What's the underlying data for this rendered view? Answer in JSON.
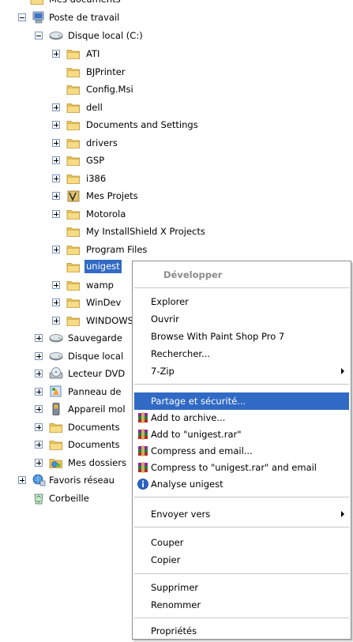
{
  "tree": {
    "top_partial": "Mes documents",
    "root": "Poste de travail",
    "drive_c": "Disque local (C:)",
    "folders": {
      "ati": "ATI",
      "bjprinter": "BJPrinter",
      "configmsi": "Config.Msi",
      "dell": "dell",
      "docsettings": "Documents and Settings",
      "drivers": "drivers",
      "gsp": "GSP",
      "i386": "i386",
      "mesprojets": "Mes Projets",
      "motorola": "Motorola",
      "installshield": "My InstallShield X Projects",
      "programfiles": "Program Files",
      "unigest": "unigest",
      "wamp": "wamp",
      "windev": "WinDev",
      "windows": "WINDOWS"
    },
    "others": {
      "sauvegarde": "Sauvegarde",
      "disque_local": "Disque local",
      "lecteur_dvd": "Lecteur DVD",
      "panneau": "Panneau de",
      "appareil": "Appareil mol",
      "documents1": "Documents",
      "documents2": "Documents",
      "mes_dossiers": "Mes dossiers"
    },
    "favoris": "Favoris réseau",
    "corbeille": "Corbeille"
  },
  "menu": {
    "developper": "Développer",
    "explorer": "Explorer",
    "ouvrir": "Ouvrir",
    "paintshop": "Browse With Paint Shop Pro 7",
    "rechercher": "Rechercher...",
    "zip": "7-Zip",
    "partage": "Partage et sécurité...",
    "add_archive": "Add to archive...",
    "add_rar": "Add to \"unigest.rar\"",
    "compress_email": "Compress and email...",
    "compress_rar_email": "Compress to \"unigest.rar\" and email",
    "analyse": "Analyse unigest",
    "envoyer": "Envoyer vers",
    "couper": "Couper",
    "copier": "Copier",
    "supprimer": "Supprimer",
    "renommer": "Renommer",
    "proprietes": "Propriétés"
  },
  "colors": {
    "selection": "#316ac5",
    "folder": "#f2d27a"
  }
}
